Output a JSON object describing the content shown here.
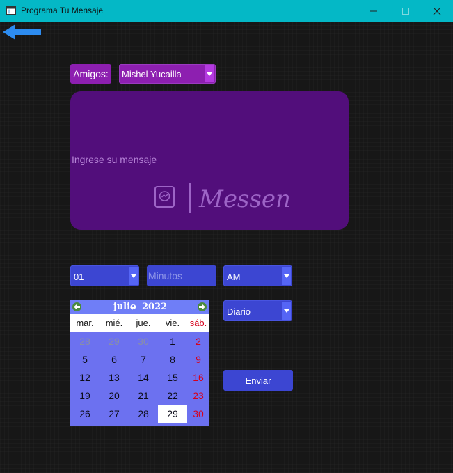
{
  "window": {
    "title": "Programa Tu Mensaje"
  },
  "colors": {
    "titlebar": "#04b8c6",
    "purple": "#8d1fb0",
    "message_box": "#520e7b",
    "blue_control": "#3c46d2",
    "calendar": "#6c71f0",
    "back_arrow": "#2d8cf0",
    "weekend": "#d6001c"
  },
  "form": {
    "friends_label": "Amigos:",
    "friend_selected": "Mishel Yucailla",
    "message_placeholder": "Ingrese su mensaje",
    "messenger_brand": "Messenger",
    "hour_selected": "01",
    "minutes_placeholder": "Minutos",
    "ampm_selected": "AM",
    "frequency_selected": "Diario",
    "send_label": "Enviar"
  },
  "calendar": {
    "month": "julio",
    "year": "2022",
    "weekdays": [
      "mar.",
      "mié.",
      "jue.",
      "vie.",
      "sáb."
    ],
    "rows": [
      [
        {
          "d": "28",
          "other": true
        },
        {
          "d": "29",
          "other": true
        },
        {
          "d": "30",
          "other": true
        },
        {
          "d": "1"
        },
        {
          "d": "2",
          "weekend": true
        }
      ],
      [
        {
          "d": "5"
        },
        {
          "d": "6"
        },
        {
          "d": "7"
        },
        {
          "d": "8"
        },
        {
          "d": "9",
          "weekend": true
        }
      ],
      [
        {
          "d": "12"
        },
        {
          "d": "13"
        },
        {
          "d": "14"
        },
        {
          "d": "15"
        },
        {
          "d": "16",
          "weekend": true
        }
      ],
      [
        {
          "d": "19"
        },
        {
          "d": "20"
        },
        {
          "d": "21"
        },
        {
          "d": "22"
        },
        {
          "d": "23",
          "weekend": true
        }
      ],
      [
        {
          "d": "26"
        },
        {
          "d": "27"
        },
        {
          "d": "28"
        },
        {
          "d": "29",
          "selected": true
        },
        {
          "d": "30",
          "weekend": true
        }
      ]
    ]
  }
}
